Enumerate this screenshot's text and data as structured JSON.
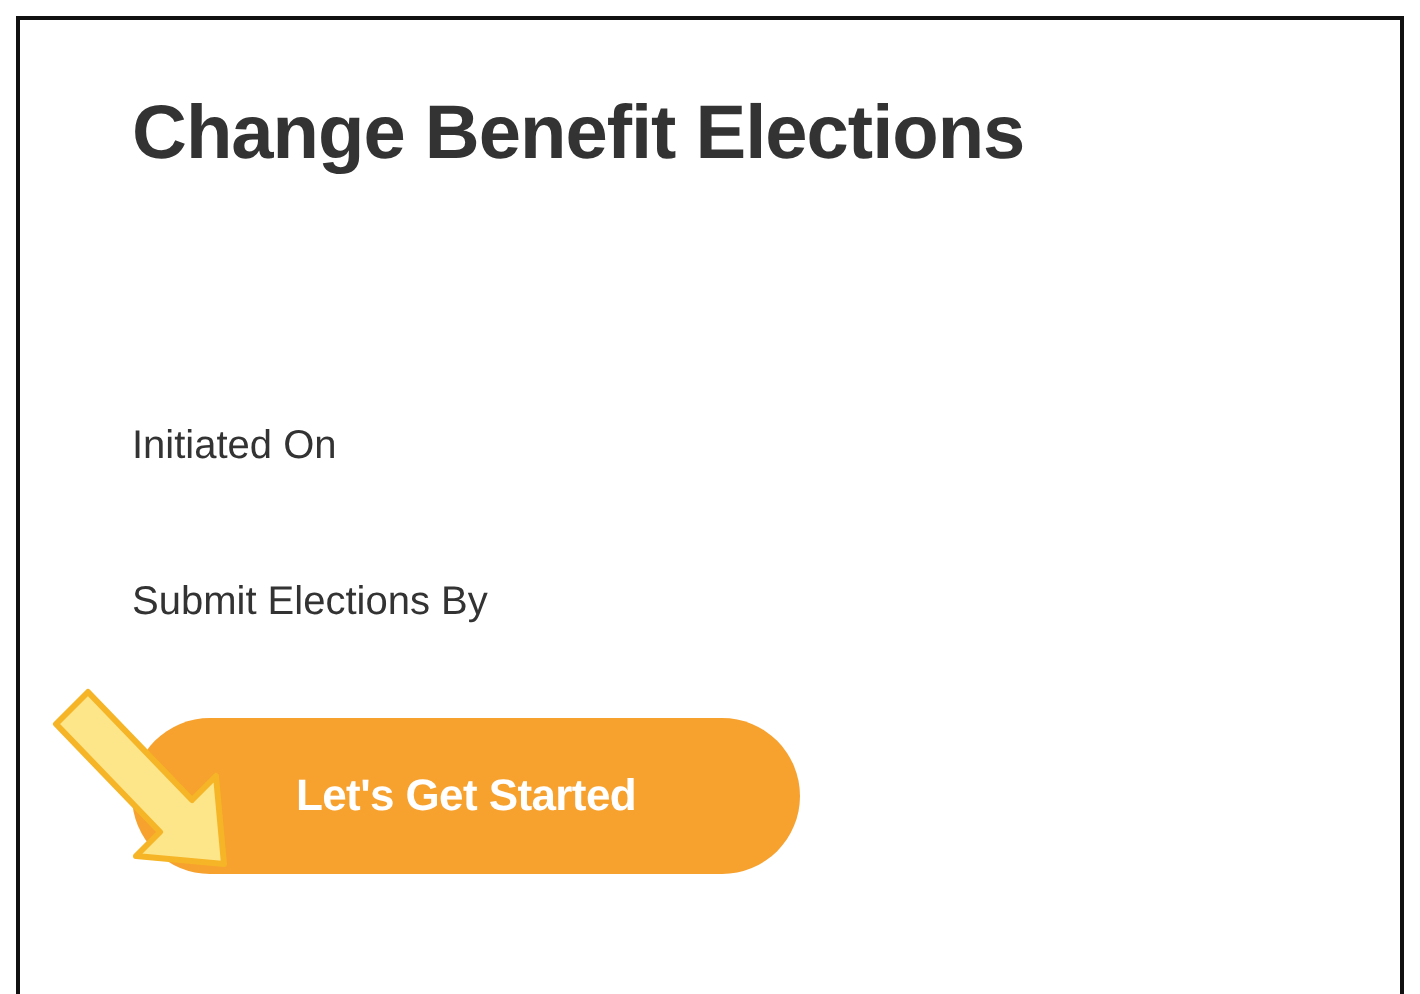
{
  "title": "Change Benefit Elections",
  "fields": [
    {
      "label": "Initiated On"
    },
    {
      "label": "Submit Elections By"
    }
  ],
  "button": {
    "label": "Let's Get Started"
  }
}
